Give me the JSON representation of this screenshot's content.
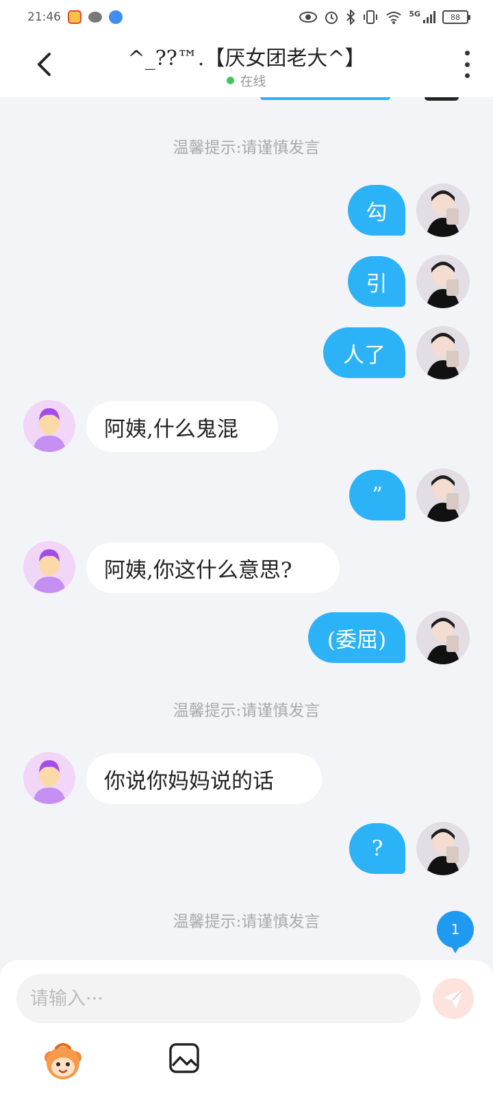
{
  "status_bar": {
    "time": "21:46",
    "network": "5G",
    "battery": "88"
  },
  "header": {
    "title": "^_??™.【厌女团老大^】",
    "status": "在线"
  },
  "notices": [
    "温馨提示:请谨慎发言",
    "温馨提示:请谨慎发言",
    "温馨提示:请谨慎发言"
  ],
  "messages": [
    {
      "side": "me",
      "text": "勾"
    },
    {
      "side": "me",
      "text": "引"
    },
    {
      "side": "me",
      "text": "人了"
    },
    {
      "side": "other",
      "text": "阿姨,什么鬼混"
    },
    {
      "side": "me",
      "text": "”"
    },
    {
      "side": "other",
      "text": "阿姨,你这什么意思?"
    },
    {
      "side": "me",
      "text": "(委屈)"
    },
    {
      "side": "other",
      "text": "你说你妈妈说的话"
    },
    {
      "side": "me",
      "text": "?"
    }
  ],
  "unread_badge": "1",
  "input": {
    "placeholder": "请输入···"
  },
  "colors": {
    "accent": "#2bb2f7",
    "online": "#3dc75a",
    "background": "#f3f4f8"
  },
  "icons": [
    "back-arrow-icon",
    "more-vertical-icon",
    "send-icon",
    "emoji-icon",
    "image-icon"
  ]
}
